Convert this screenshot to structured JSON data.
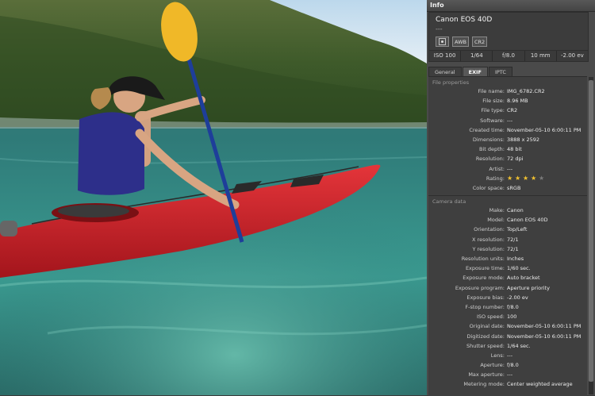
{
  "panel": {
    "title": "Info",
    "camera": {
      "name": "Canon EOS 40D",
      "sub": "---",
      "badges": [
        "AWB",
        "CR2"
      ]
    },
    "settings": [
      "ISO 100",
      "1/64",
      "f/8.0",
      "10 mm",
      "-2.00 ev"
    ],
    "tabs": [
      {
        "label": "General",
        "active": false
      },
      {
        "label": "EXIF",
        "active": true
      },
      {
        "label": "IPTC",
        "active": false
      }
    ],
    "file_section": "File properties",
    "file_props": [
      {
        "label": "File name:",
        "value": "IMG_6782.CR2"
      },
      {
        "label": "File size:",
        "value": "8.96 MB"
      },
      {
        "label": "File type:",
        "value": "CR2"
      },
      {
        "label": "Software:",
        "value": "---"
      },
      {
        "label": "Created time:",
        "value": "November-05-10 6:00:11 PM"
      },
      {
        "label": "Dimensions:",
        "value": "3888 x 2592"
      },
      {
        "label": "Bit depth:",
        "value": "48 bit"
      },
      {
        "label": "Resolution:",
        "value": "72 dpi"
      },
      {
        "label": "Artist:",
        "value": "---"
      }
    ],
    "rating": {
      "label": "Rating:",
      "value": 4,
      "max": 5
    },
    "color_space": {
      "label": "Color space:",
      "value": "sRGB"
    },
    "camera_section": "Camera data",
    "camera_props": [
      {
        "label": "Make:",
        "value": "Canon"
      },
      {
        "label": "Model:",
        "value": "Canon EOS 40D"
      },
      {
        "label": "Orientation:",
        "value": "Top/Left"
      },
      {
        "label": "X resolution:",
        "value": "72/1"
      },
      {
        "label": "Y resolution:",
        "value": "72/1"
      },
      {
        "label": "Resolution units:",
        "value": "Inches"
      },
      {
        "label": "Exposure time:",
        "value": "1/60 sec."
      },
      {
        "label": "Exposure mode:",
        "value": "Auto bracket"
      },
      {
        "label": "Exposure program:",
        "value": "Aperture priority"
      },
      {
        "label": "Exposure bias:",
        "value": "-2.00 ev"
      },
      {
        "label": "F-stop number:",
        "value": "f/8.0"
      },
      {
        "label": "ISO speed:",
        "value": "100"
      },
      {
        "label": "Original date:",
        "value": "November-05-10 6:00:11 PM"
      },
      {
        "label": "Digitized date:",
        "value": "November-05-10 6:00:11 PM"
      },
      {
        "label": "Shutter speed:",
        "value": "1/64 sec."
      },
      {
        "label": "Lens:",
        "value": "---"
      },
      {
        "label": "Aperture:",
        "value": "f/8.0"
      },
      {
        "label": "Max aperture:",
        "value": "---"
      },
      {
        "label": "Metering mode:",
        "value": "Center weighted average"
      }
    ]
  }
}
